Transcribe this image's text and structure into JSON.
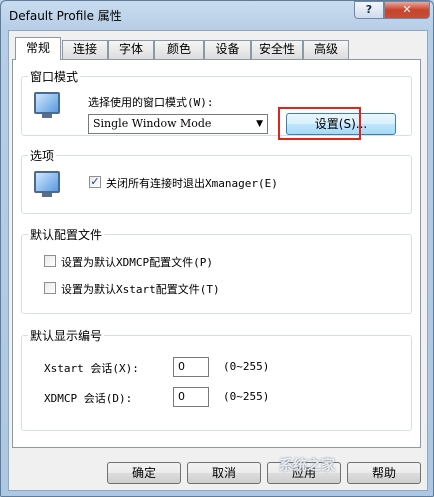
{
  "window": {
    "title": "Default Profile 属性",
    "help_glyph": "?",
    "close_glyph": "✕"
  },
  "tabs": [
    "常规",
    "连接",
    "字体",
    "颜色",
    "设备",
    "安全性",
    "高级"
  ],
  "window_mode": {
    "title": "窗口模式",
    "prompt": "选择使用的窗口模式(W):",
    "selected": "Single Window Mode",
    "settings_button": "设置(S)..."
  },
  "options": {
    "title": "选项",
    "exit_on_close_all": {
      "label": "关闭所有连接时退出Xmanager(E)",
      "checked": true
    }
  },
  "default_config": {
    "title": "默认配置文件",
    "xdmcp_default": {
      "label": "设置为默认XDMCP配置文件(P)",
      "checked": false
    },
    "xstart_default": {
      "label": "设置为默认Xstart配置文件(T)",
      "checked": false
    }
  },
  "display_number": {
    "title": "默认显示编号",
    "xstart": {
      "label": "Xstart 会话(X):",
      "value": "0",
      "range": "(0~255)"
    },
    "xdmcp": {
      "label": "XDMCP 会话(D):",
      "value": "0",
      "range": "(0~255)"
    }
  },
  "footer": {
    "ok": "确定",
    "cancel": "取消",
    "apply_partial": "应用",
    "help_partial": "帮助"
  },
  "watermark": "系统之家"
}
